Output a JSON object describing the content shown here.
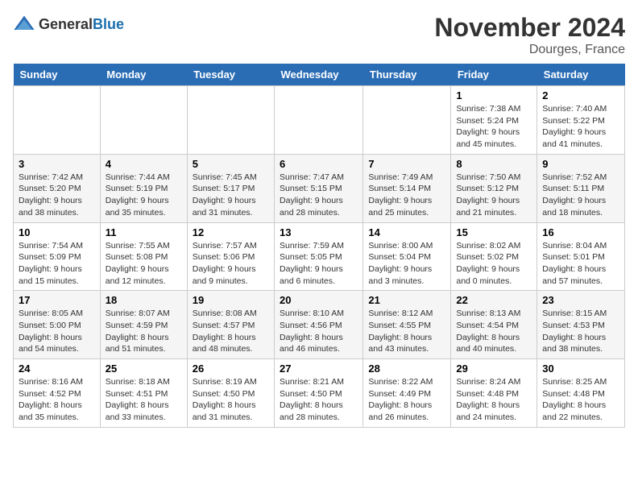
{
  "logo": {
    "general": "General",
    "blue": "Blue"
  },
  "title": "November 2024",
  "location": "Dourges, France",
  "days_header": [
    "Sunday",
    "Monday",
    "Tuesday",
    "Wednesday",
    "Thursday",
    "Friday",
    "Saturday"
  ],
  "weeks": [
    [
      {
        "day": "",
        "info": ""
      },
      {
        "day": "",
        "info": ""
      },
      {
        "day": "",
        "info": ""
      },
      {
        "day": "",
        "info": ""
      },
      {
        "day": "",
        "info": ""
      },
      {
        "day": "1",
        "info": "Sunrise: 7:38 AM\nSunset: 5:24 PM\nDaylight: 9 hours and 45 minutes."
      },
      {
        "day": "2",
        "info": "Sunrise: 7:40 AM\nSunset: 5:22 PM\nDaylight: 9 hours and 41 minutes."
      }
    ],
    [
      {
        "day": "3",
        "info": "Sunrise: 7:42 AM\nSunset: 5:20 PM\nDaylight: 9 hours and 38 minutes."
      },
      {
        "day": "4",
        "info": "Sunrise: 7:44 AM\nSunset: 5:19 PM\nDaylight: 9 hours and 35 minutes."
      },
      {
        "day": "5",
        "info": "Sunrise: 7:45 AM\nSunset: 5:17 PM\nDaylight: 9 hours and 31 minutes."
      },
      {
        "day": "6",
        "info": "Sunrise: 7:47 AM\nSunset: 5:15 PM\nDaylight: 9 hours and 28 minutes."
      },
      {
        "day": "7",
        "info": "Sunrise: 7:49 AM\nSunset: 5:14 PM\nDaylight: 9 hours and 25 minutes."
      },
      {
        "day": "8",
        "info": "Sunrise: 7:50 AM\nSunset: 5:12 PM\nDaylight: 9 hours and 21 minutes."
      },
      {
        "day": "9",
        "info": "Sunrise: 7:52 AM\nSunset: 5:11 PM\nDaylight: 9 hours and 18 minutes."
      }
    ],
    [
      {
        "day": "10",
        "info": "Sunrise: 7:54 AM\nSunset: 5:09 PM\nDaylight: 9 hours and 15 minutes."
      },
      {
        "day": "11",
        "info": "Sunrise: 7:55 AM\nSunset: 5:08 PM\nDaylight: 9 hours and 12 minutes."
      },
      {
        "day": "12",
        "info": "Sunrise: 7:57 AM\nSunset: 5:06 PM\nDaylight: 9 hours and 9 minutes."
      },
      {
        "day": "13",
        "info": "Sunrise: 7:59 AM\nSunset: 5:05 PM\nDaylight: 9 hours and 6 minutes."
      },
      {
        "day": "14",
        "info": "Sunrise: 8:00 AM\nSunset: 5:04 PM\nDaylight: 9 hours and 3 minutes."
      },
      {
        "day": "15",
        "info": "Sunrise: 8:02 AM\nSunset: 5:02 PM\nDaylight: 9 hours and 0 minutes."
      },
      {
        "day": "16",
        "info": "Sunrise: 8:04 AM\nSunset: 5:01 PM\nDaylight: 8 hours and 57 minutes."
      }
    ],
    [
      {
        "day": "17",
        "info": "Sunrise: 8:05 AM\nSunset: 5:00 PM\nDaylight: 8 hours and 54 minutes."
      },
      {
        "day": "18",
        "info": "Sunrise: 8:07 AM\nSunset: 4:59 PM\nDaylight: 8 hours and 51 minutes."
      },
      {
        "day": "19",
        "info": "Sunrise: 8:08 AM\nSunset: 4:57 PM\nDaylight: 8 hours and 48 minutes."
      },
      {
        "day": "20",
        "info": "Sunrise: 8:10 AM\nSunset: 4:56 PM\nDaylight: 8 hours and 46 minutes."
      },
      {
        "day": "21",
        "info": "Sunrise: 8:12 AM\nSunset: 4:55 PM\nDaylight: 8 hours and 43 minutes."
      },
      {
        "day": "22",
        "info": "Sunrise: 8:13 AM\nSunset: 4:54 PM\nDaylight: 8 hours and 40 minutes."
      },
      {
        "day": "23",
        "info": "Sunrise: 8:15 AM\nSunset: 4:53 PM\nDaylight: 8 hours and 38 minutes."
      }
    ],
    [
      {
        "day": "24",
        "info": "Sunrise: 8:16 AM\nSunset: 4:52 PM\nDaylight: 8 hours and 35 minutes."
      },
      {
        "day": "25",
        "info": "Sunrise: 8:18 AM\nSunset: 4:51 PM\nDaylight: 8 hours and 33 minutes."
      },
      {
        "day": "26",
        "info": "Sunrise: 8:19 AM\nSunset: 4:50 PM\nDaylight: 8 hours and 31 minutes."
      },
      {
        "day": "27",
        "info": "Sunrise: 8:21 AM\nSunset: 4:50 PM\nDaylight: 8 hours and 28 minutes."
      },
      {
        "day": "28",
        "info": "Sunrise: 8:22 AM\nSunset: 4:49 PM\nDaylight: 8 hours and 26 minutes."
      },
      {
        "day": "29",
        "info": "Sunrise: 8:24 AM\nSunset: 4:48 PM\nDaylight: 8 hours and 24 minutes."
      },
      {
        "day": "30",
        "info": "Sunrise: 8:25 AM\nSunset: 4:48 PM\nDaylight: 8 hours and 22 minutes."
      }
    ]
  ]
}
